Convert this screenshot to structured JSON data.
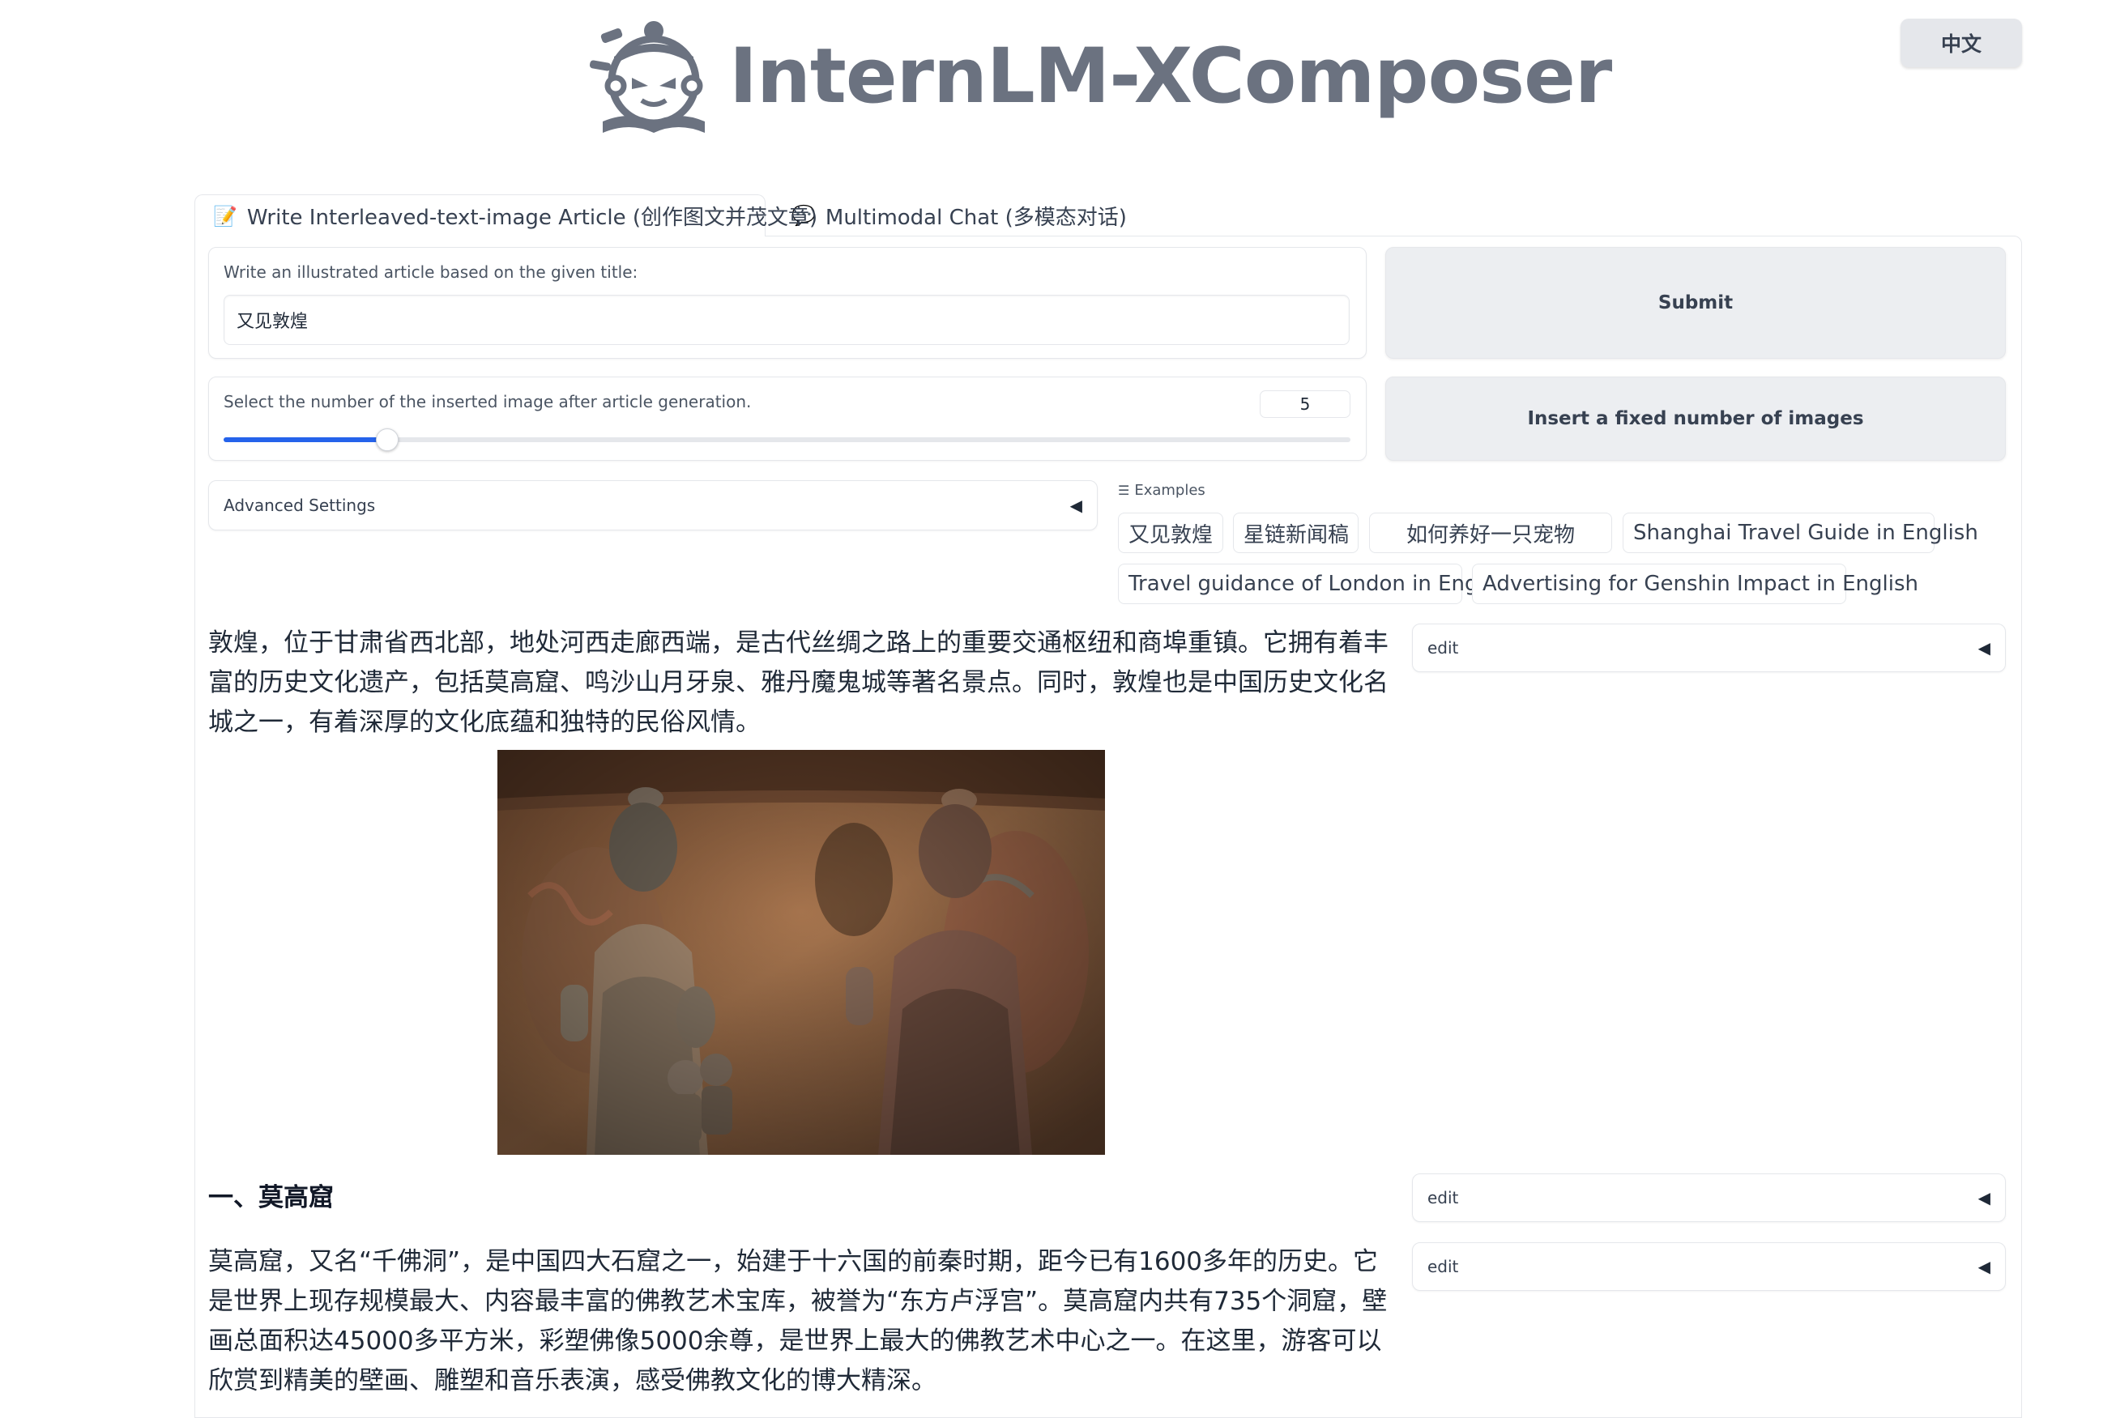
{
  "header": {
    "title": "InternLM-XComposer",
    "lang_button": "中文"
  },
  "tabs": [
    {
      "label": "Write Interleaved-text-image Article (创作图文并茂文章)",
      "icon": "pencil-icon",
      "active": true
    },
    {
      "label": "Multimodal Chat (多模态对话)",
      "icon": "speech-bubble-icon",
      "active": false
    }
  ],
  "title_input": {
    "label": "Write an illustrated article based on the given title:",
    "value": "又见敦煌"
  },
  "slider": {
    "label": "Select the number of the inserted image after article generation.",
    "value": "5",
    "fraction": 0.145
  },
  "buttons": {
    "submit": "Submit",
    "insert": "Insert a fixed number of images"
  },
  "advanced": {
    "label": "Advanced Settings",
    "caret": "◀"
  },
  "examples": {
    "label": "Examples",
    "items": [
      "又见敦煌",
      "星链新闻稿",
      "如何养好一只宠物",
      "Shanghai Travel Guide in English",
      "Travel guidance of London in English",
      "Advertising for Genshin Impact in English"
    ]
  },
  "article": {
    "para1": "敦煌，位于甘肃省西北部，地处河西走廊西端，是古代丝绸之路上的重要交通枢纽和商埠重镇。它拥有着丰富的历史文化遗产，包括莫高窟、鸣沙山月牙泉、雅丹魔鬼城等著名景点。同时，敦煌也是中国历史文化名城之一，有着深厚的文化底蕴和独特的民俗风情。",
    "heading1": "一、莫高窟",
    "para2": "莫高窟，又名“千佛洞”，是中国四大石窟之一，始建于十六国的前秦时期，距今已有1600多年的历史。它是世界上现存规模最大、内容最丰富的佛教艺术宝库，被誉为“东方卢浮宫”。莫高窟内共有735个洞窟，壁画总面积达45000多平方米，彩塑佛像5000余尊，是世界上最大的佛教艺术中心之一。在这里，游客可以欣赏到精美的壁画、雕塑和音乐表演，感受佛教文化的博大精深。"
  },
  "edit_panels": [
    {
      "label": "edit",
      "caret": "◀"
    },
    {
      "label": "edit",
      "caret": "◀"
    },
    {
      "label": "edit",
      "caret": "◀"
    }
  ],
  "colors": {
    "accent": "#2563eb",
    "brand_gray": "#6b7280",
    "button_bg": "#eceef1"
  }
}
